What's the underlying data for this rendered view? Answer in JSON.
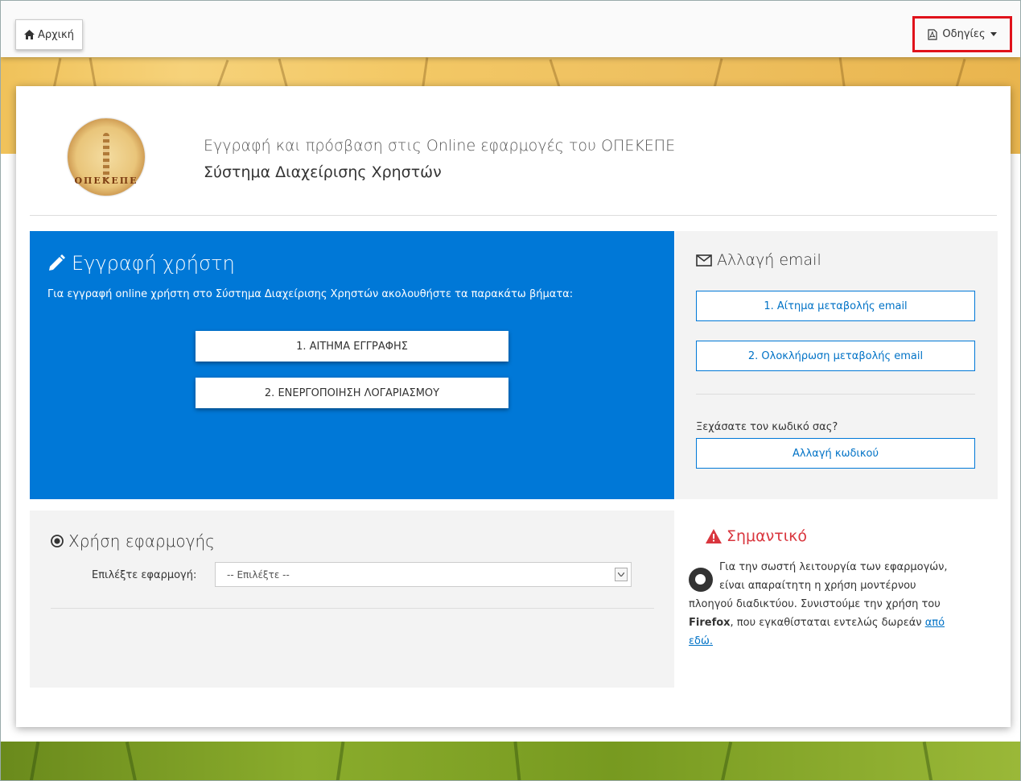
{
  "topbar": {
    "home_label": "Αρχική",
    "guides_label": "Οδηγίες"
  },
  "header": {
    "subtitle": "Εγγραφή και πρόσβαση στις Online εφαρμογές του ΟΠΕΚΕΠΕ",
    "title": "Σύστημα Διαχείρισης Χρηστών",
    "logo_text": "ΟΠΕΚΕΠΕ"
  },
  "registration": {
    "heading": "Εγγραφή χρήστη",
    "instructions": "Για εγγραφή online χρήστη στο Σύστημα Διαχείρισης Χρηστών ακολουθήστε τα παρακάτω βήματα:",
    "step1": "1. ΑΙΤΗΜΑ ΕΓΓΡΑΦΗΣ",
    "step2": "2. ΕΝΕΡΓΟΠΟΙΗΣΗ ΛΟΓΑΡΙΑΣΜΟΥ",
    "background": "#0078d7"
  },
  "email_change": {
    "heading": "Αλλαγή email",
    "request_label": "1. Αίτημα μεταβολής email",
    "complete_label": "2. Ολοκλήρωση μεταβολής email",
    "forgot_text": "Ξεχάσατε τον κωδικό σας?",
    "change_password_label": "Αλλαγή κωδικού"
  },
  "app_usage": {
    "heading": "Χρήση εφαρμογής",
    "select_label": "Επιλέξτε εφαρμογή:",
    "select_value": "-- Επιλέξτε --"
  },
  "important": {
    "heading": "Σημαντικό",
    "text_before": "Για την σωστή λειτουργία των εφαρμογών, είναι απαραίτητη η χρήση μοντέρνου πλοηγού διαδικτύου. Συνιστούμε την χρήση του ",
    "browser": "Firefox",
    "text_after": ", που εγκαθίσταται εντελώς δωρεάν ",
    "link": "από εδώ.",
    "heading_color": "#d9363e"
  },
  "icons": [
    "home-icon",
    "pdf-icon",
    "pencil-icon",
    "envelope-icon",
    "target-icon",
    "warning-icon",
    "firefox-icon"
  ]
}
